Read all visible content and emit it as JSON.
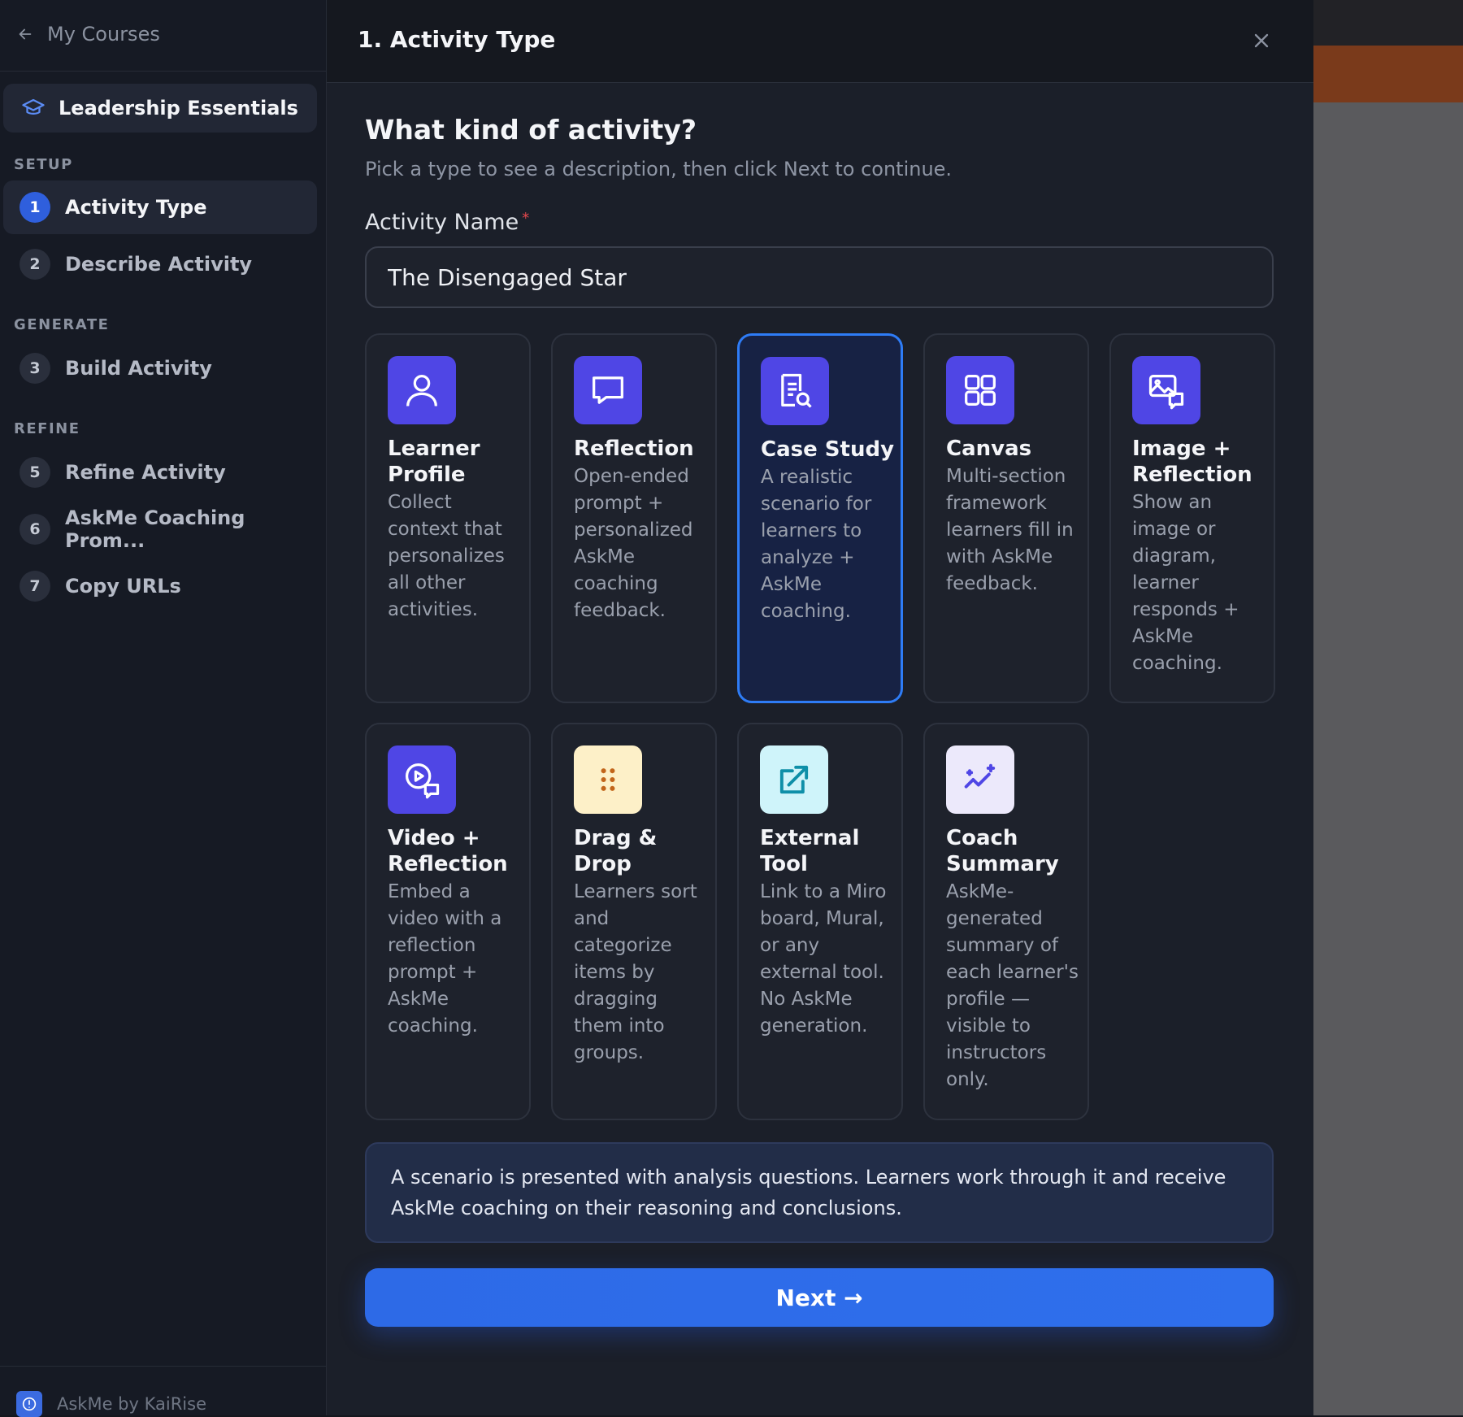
{
  "sidebar": {
    "back_label": "My Courses",
    "course_title": "Leadership Essentials",
    "sections": {
      "setup": "SETUP",
      "generate": "GENERATE",
      "refine": "REFINE"
    },
    "steps": [
      {
        "num": "1",
        "label": "Activity Type"
      },
      {
        "num": "2",
        "label": "Describe Activity"
      },
      {
        "num": "3",
        "label": "Build Activity"
      },
      {
        "num": "5",
        "label": "Refine Activity"
      },
      {
        "num": "6",
        "label": "AskMe Coaching Prom..."
      },
      {
        "num": "7",
        "label": "Copy URLs"
      }
    ],
    "footer": "AskMe by KaiRise"
  },
  "modal": {
    "title": "1. Activity Type",
    "question": "What kind of activity?",
    "subtitle": "Pick a type to see a description, then click Next to continue.",
    "field_label": "Activity Name",
    "required_mark": "*",
    "activity_name": "The Disengaged Star",
    "cards": [
      {
        "title": "Learner Profile",
        "desc": "Collect context that personalizes all other activities.",
        "icon": "user-icon"
      },
      {
        "title": "Reflection",
        "desc": "Open-ended prompt + personalized AskMe coaching feedback.",
        "icon": "chat-bubble-icon"
      },
      {
        "title": "Case Study",
        "desc": "A realistic scenario for learners to analyze + AskMe coaching.",
        "icon": "document-search-icon",
        "selected": true
      },
      {
        "title": "Canvas",
        "desc": "Multi-section framework learners fill in with AskMe feedback.",
        "icon": "grid-icon"
      },
      {
        "title": "Image + Reflection",
        "desc": "Show an image or diagram, learner responds + AskMe coaching.",
        "icon": "image-chat-icon"
      },
      {
        "title": "Video + Reflection",
        "desc": "Embed a video with a reflection prompt + AskMe coaching.",
        "icon": "video-chat-icon"
      },
      {
        "title": "Drag & Drop",
        "desc": "Learners sort and categorize items by dragging them into groups.",
        "icon": "drag-handle-icon"
      },
      {
        "title": "External Tool",
        "desc": "Link to a Miro board, Mural, or any external tool. No AskMe generation.",
        "icon": "external-link-icon"
      },
      {
        "title": "Coach Summary",
        "desc": "AskMe-generated summary of each learner's profile — visible to instructors only.",
        "icon": "sparkle-chart-icon"
      }
    ],
    "description": "A scenario is presented with analysis questions. Learners work through it and receive AskMe coaching on their reasoning and conclusions.",
    "next_label": "Next →"
  },
  "colors": {
    "accent": "#2f6fec",
    "selected_border": "#2e7cf6",
    "icon_purple": "#4f46e5",
    "icon_yellow_bg": "#fdf0c8",
    "icon_cyan_bg": "#cff4fa",
    "icon_lavender_bg": "#ece9fb"
  }
}
